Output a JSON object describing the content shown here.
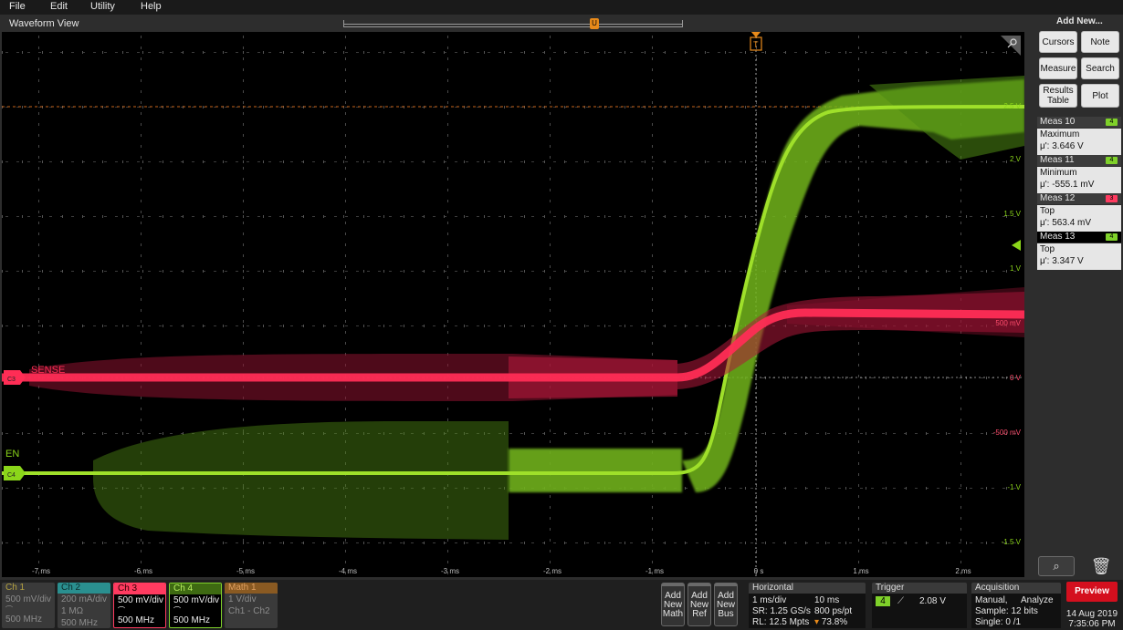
{
  "menu": [
    "File",
    "Edit",
    "Utility",
    "Help"
  ],
  "waveform_view": {
    "title": "Waveform View",
    "timebase_marker": "U",
    "trigger_marker": "T",
    "x_ticks": [
      "-7 ms",
      "-6 ms",
      "-5 ms",
      "-4 ms",
      "-3 ms",
      "-2 ms",
      "-1 ms",
      "0 s",
      "1 ms",
      "2 ms"
    ],
    "y_ticks_ch4": [
      "2.5 V",
      "2 V",
      "1.5 V",
      "1 V",
      "-1 V",
      "-1.5 V"
    ],
    "y_ticks_ch3": [
      "500 mV",
      "0 V",
      "-500 mV"
    ],
    "ch3_label": "SENSE",
    "ch4_label": "EN",
    "ch3_badge": "C3",
    "ch4_badge": "C4"
  },
  "right_panel": {
    "add_new": "Add New...",
    "buttons": [
      {
        "label": "Cursors"
      },
      {
        "label": "Note"
      },
      {
        "label": "Measure"
      },
      {
        "label": "Search"
      },
      {
        "label": "Results Table"
      },
      {
        "label": "Plot"
      }
    ],
    "measurements": [
      {
        "name": "Meas 10",
        "chip": "4",
        "chip_color": "#7fd12a",
        "type": "Maximum",
        "value": "μ': 3.646 V",
        "active": false
      },
      {
        "name": "Meas 11",
        "chip": "4",
        "chip_color": "#7fd12a",
        "type": "Minimum",
        "value": "μ': -555.1 mV",
        "active": false
      },
      {
        "name": "Meas 12",
        "chip": "3",
        "chip_color": "#ff3b60",
        "type": "Top",
        "value": "μ': 563.4 mV",
        "active": false
      },
      {
        "name": "Meas 13",
        "chip": "4",
        "chip_color": "#7fd12a",
        "type": "Top",
        "value": "μ': 3.347 V",
        "active": true
      }
    ]
  },
  "channels": [
    {
      "name": "Ch 1",
      "line1": "500 mV/div",
      "line2": "",
      "line3": "500 MHz",
      "on": false,
      "color": "#e0c23a"
    },
    {
      "name": "Ch 2",
      "line1": "200 mA/div",
      "line2": "1 MΩ",
      "line3": "500 MHz",
      "on": false,
      "color": "#2ab3b3"
    },
    {
      "name": "Ch 3",
      "line1": "500 mV/div",
      "line2": "",
      "line3": "500 MHz",
      "on": true,
      "color": "#ff3b60"
    },
    {
      "name": "Ch 4",
      "line1": "500 mV/div",
      "line2": "",
      "line3": "500 MHz",
      "on": true,
      "color": "#7fd12a"
    },
    {
      "name": "Math 1",
      "line1": "1 V/div",
      "line2": "Ch1 - Ch2",
      "line3": "",
      "on": false,
      "color": "#e88a1a"
    }
  ],
  "add_buttons": [
    {
      "line1": "Add",
      "line2": "New",
      "line3": "Math"
    },
    {
      "line1": "Add",
      "line2": "New",
      "line3": "Ref"
    },
    {
      "line1": "Add",
      "line2": "New",
      "line3": "Bus"
    }
  ],
  "horizontal": {
    "title": "Horizontal",
    "scale": "1 ms/div",
    "position": "10 ms",
    "sample_rate": "SR: 1.25 GS/s",
    "pt": "800 ps/pt",
    "record_length": "RL: 12.5 Mpts",
    "percent": "73.8%"
  },
  "trigger": {
    "title": "Trigger",
    "source": "4",
    "level": "2.08 V"
  },
  "acquisition": {
    "title": "Acquisition",
    "mode": "Manual,",
    "analyze": "Analyze",
    "sample": "Sample: 12 bits",
    "single": "Single: 0 /1"
  },
  "preview_label": "Preview",
  "date": "14 Aug 2019",
  "time": "7:35:06 PM",
  "colors": {
    "ch3": "#ff2d55",
    "ch4": "#8bd61a",
    "trigger": "#e88a1a"
  }
}
